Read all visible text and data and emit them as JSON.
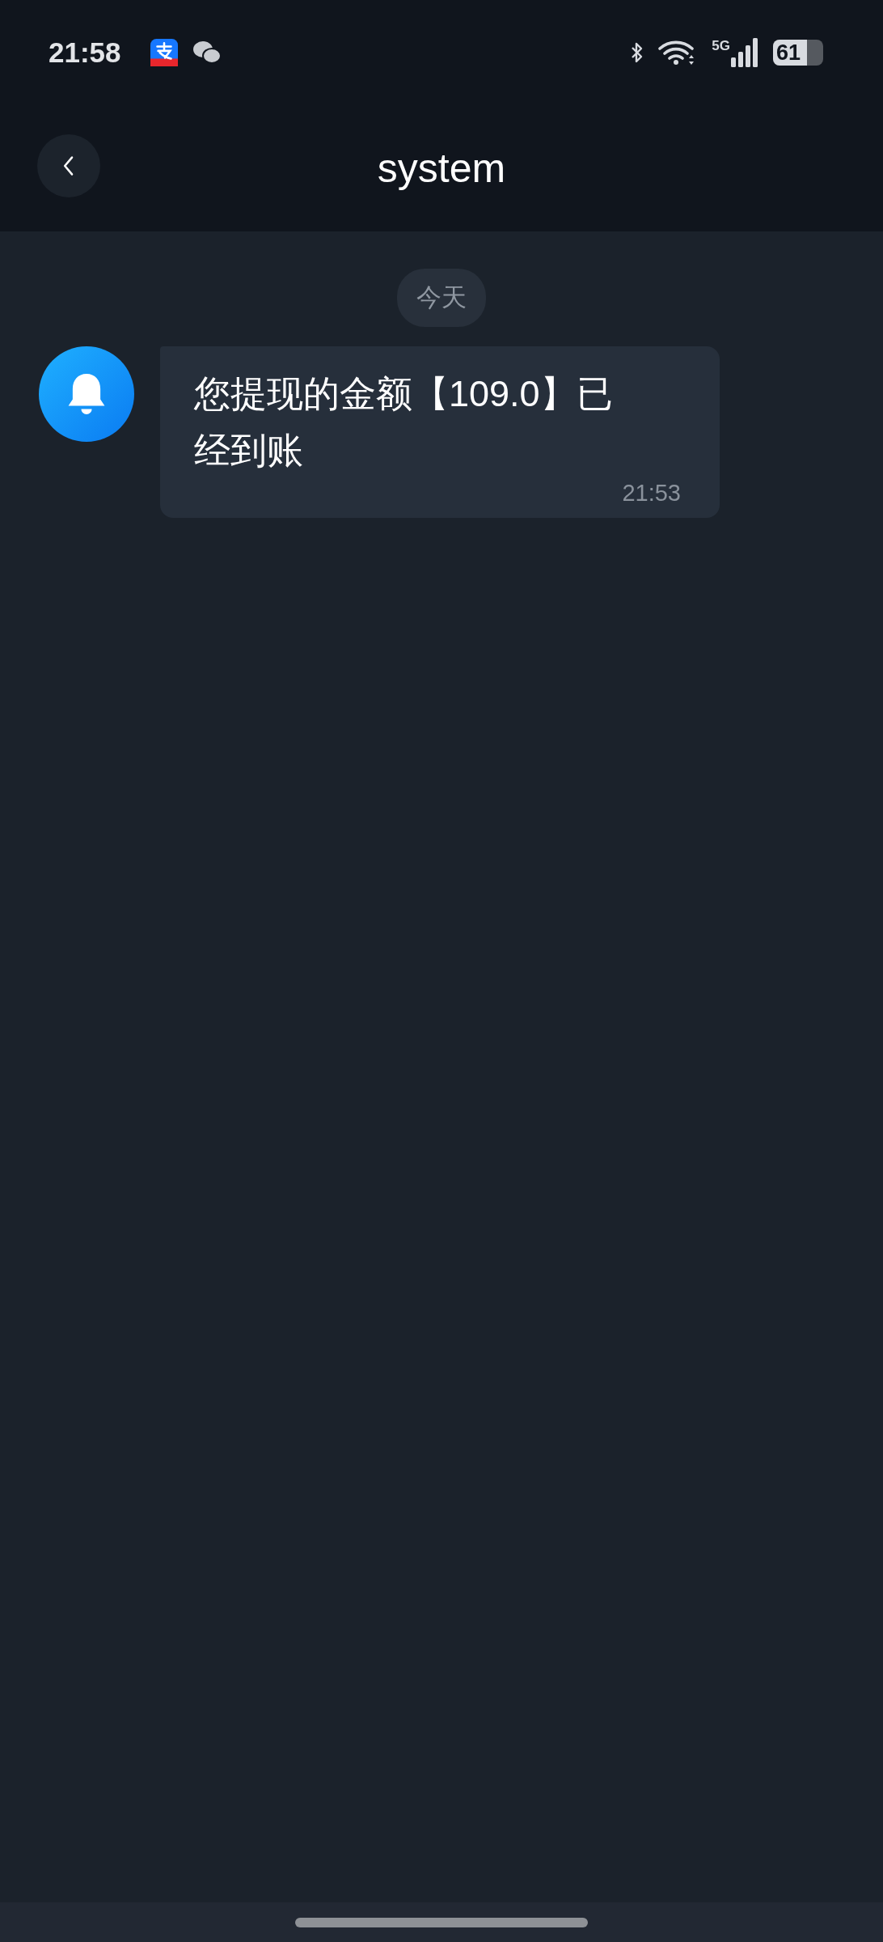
{
  "status_bar": {
    "time": "21:58",
    "network": "5G",
    "battery": "61"
  },
  "header": {
    "title": "system"
  },
  "date_divider": "今天",
  "messages": [
    {
      "text": "您提现的金额【109.0】已经到账",
      "time": "21:53"
    }
  ]
}
